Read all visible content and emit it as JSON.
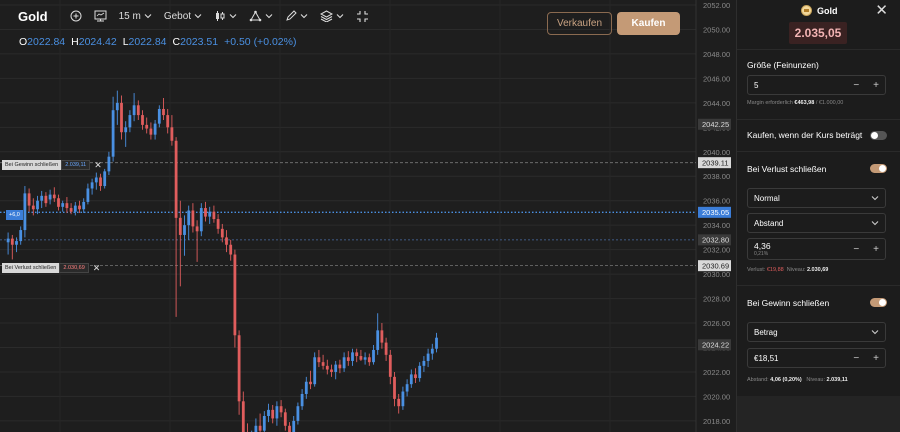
{
  "toolbar": {
    "title": "Gold",
    "timeframe": "15 m",
    "price_type": "Gebot"
  },
  "ohlc": {
    "o_label": "O",
    "o_value": "2022.84",
    "h_label": "H",
    "h_value": "2024.42",
    "l_label": "L",
    "l_value": "2022.84",
    "c_label": "C",
    "c_value": "2023.51",
    "change": "+0.50 (+0.02%)"
  },
  "trade_buttons": {
    "sell": "Verkaufen",
    "buy": "Kaufen"
  },
  "order_lines": {
    "take_profit": {
      "label": "Bei Gewinn schließen",
      "value": "2.039,11"
    },
    "stop_loss": {
      "label": "Bei Verlust schließen",
      "value": "2.030,69"
    },
    "position": {
      "label": "+6,0"
    }
  },
  "chart_data": {
    "type": "candlestick",
    "instrument": "Gold",
    "interval": "15 m",
    "ylim": [
      2017.5,
      2052
    ],
    "y_ticks": [
      "2052.00",
      "2050.00",
      "2048.00",
      "2046.00",
      "2044.00",
      "2042.00",
      "2040.00",
      "2038.00",
      "2036.00",
      "2034.00",
      "2032.00",
      "2030.00",
      "2028.00",
      "2026.00",
      "2024.00",
      "2022.00",
      "2020.00",
      "2018.00"
    ],
    "price_labels": [
      {
        "value": 2042.25,
        "text": "2042.25",
        "style": "gray"
      },
      {
        "value": 2039.11,
        "text": "2039.11",
        "style": "light"
      },
      {
        "value": 2035.05,
        "text": "2035.05",
        "style": "blue"
      },
      {
        "value": 2032.8,
        "text": "2032.80",
        "style": "gray"
      },
      {
        "value": 2030.69,
        "text": "2030.69",
        "style": "light"
      },
      {
        "value": 2024.22,
        "text": "2024.22",
        "style": "gray"
      }
    ],
    "horizontal_lines": [
      {
        "value": 2039.11,
        "style": "dashed-gray"
      },
      {
        "value": 2035.05,
        "style": "dotted-blue"
      },
      {
        "value": 2032.8,
        "style": "dashed-blue"
      },
      {
        "value": 2030.69,
        "style": "dashed-gray"
      }
    ],
    "colors": {
      "up": "#4a90e2",
      "down": "#e05d5d"
    },
    "candles": [
      [
        2032.6,
        2033.4,
        2031.6,
        2032.9
      ],
      [
        2032.9,
        2033.2,
        2031.2,
        2032.4
      ],
      [
        2032.4,
        2033.0,
        2031.8,
        2032.7
      ],
      [
        2032.7,
        2033.9,
        2032.4,
        2033.6
      ],
      [
        2033.6,
        2037.2,
        2033.0,
        2036.6
      ],
      [
        2036.6,
        2037.0,
        2035.1,
        2035.6
      ],
      [
        2035.6,
        2036.2,
        2034.8,
        2035.3
      ],
      [
        2035.3,
        2036.4,
        2034.9,
        2036.0
      ],
      [
        2036.0,
        2036.8,
        2035.4,
        2036.4
      ],
      [
        2036.4,
        2036.7,
        2035.5,
        2035.8
      ],
      [
        2036.1,
        2036.9,
        2035.7,
        2036.5
      ],
      [
        2036.5,
        2037.1,
        2035.9,
        2036.2
      ],
      [
        2036.2,
        2036.5,
        2035.2,
        2035.5
      ],
      [
        2035.5,
        2036.0,
        2035.1,
        2035.8
      ],
      [
        2035.8,
        2036.3,
        2035.0,
        2035.4
      ],
      [
        2035.4,
        2035.8,
        2034.9,
        2035.1
      ],
      [
        2035.1,
        2035.9,
        2034.8,
        2035.6
      ],
      [
        2035.6,
        2036.0,
        2035.0,
        2035.3
      ],
      [
        2035.3,
        2036.2,
        2035.0,
        2035.9
      ],
      [
        2035.9,
        2037.4,
        2035.7,
        2037.0
      ],
      [
        2037.0,
        2037.8,
        2036.5,
        2037.5
      ],
      [
        2037.5,
        2038.3,
        2036.9,
        2037.9
      ],
      [
        2037.9,
        2038.2,
        2036.8,
        2037.2
      ],
      [
        2037.2,
        2038.6,
        2037.0,
        2038.4
      ],
      [
        2038.4,
        2040.0,
        2038.1,
        2039.6
      ],
      [
        2039.6,
        2044.5,
        2039.2,
        2043.4
      ],
      [
        2043.4,
        2045.0,
        2042.2,
        2044.0
      ],
      [
        2044.0,
        2044.6,
        2041.0,
        2041.6
      ],
      [
        2041.6,
        2042.5,
        2040.4,
        2042.0
      ],
      [
        2042.0,
        2043.4,
        2041.6,
        2043.0
      ],
      [
        2043.0,
        2044.8,
        2042.5,
        2043.8
      ],
      [
        2043.8,
        2044.2,
        2042.6,
        2043.0
      ],
      [
        2043.0,
        2043.4,
        2041.8,
        2042.2
      ],
      [
        2042.2,
        2042.8,
        2041.5,
        2041.9
      ],
      [
        2041.9,
        2042.4,
        2041.0,
        2041.4
      ],
      [
        2041.4,
        2042.6,
        2041.0,
        2042.3
      ],
      [
        2042.3,
        2043.8,
        2042.0,
        2043.5
      ],
      [
        2043.5,
        2044.4,
        2042.6,
        2043.0
      ],
      [
        2043.0,
        2043.5,
        2041.5,
        2042.0
      ],
      [
        2042.0,
        2043.0,
        2040.5,
        2040.9
      ],
      [
        2040.9,
        2041.2,
        2026.5,
        2034.6
      ],
      [
        2034.6,
        2036.0,
        2029.0,
        2033.2
      ],
      [
        2033.2,
        2034.8,
        2031.5,
        2034.0
      ],
      [
        2034.0,
        2035.6,
        2032.8,
        2035.2
      ],
      [
        2035.2,
        2035.8,
        2033.4,
        2033.9
      ],
      [
        2033.9,
        2034.4,
        2031.0,
        2033.5
      ],
      [
        2033.5,
        2035.8,
        2033.1,
        2035.4
      ],
      [
        2035.4,
        2035.9,
        2034.3,
        2034.7
      ],
      [
        2034.7,
        2035.5,
        2034.1,
        2035.1
      ],
      [
        2035.1,
        2035.6,
        2034.2,
        2034.5
      ],
      [
        2034.5,
        2034.9,
        2033.3,
        2033.7
      ],
      [
        2033.7,
        2034.1,
        2032.6,
        2033.0
      ],
      [
        2033.0,
        2033.6,
        2031.8,
        2032.4
      ],
      [
        2032.4,
        2032.8,
        2031.1,
        2031.6
      ],
      [
        2031.6,
        2032.0,
        2024.0,
        2025.0
      ],
      [
        2025.0,
        2025.4,
        2018.5,
        2019.6
      ],
      [
        2019.6,
        2020.4,
        2015.5,
        2017.0
      ],
      [
        2017.0,
        2017.8,
        2014.0,
        2015.4
      ],
      [
        2015.4,
        2017.2,
        2014.8,
        2016.8
      ],
      [
        2016.8,
        2018.2,
        2016.2,
        2017.6
      ],
      [
        2017.6,
        2018.6,
        2016.6,
        2017.2
      ],
      [
        2017.2,
        2018.8,
        2016.9,
        2018.4
      ],
      [
        2018.4,
        2019.4,
        2017.9,
        2018.9
      ],
      [
        2018.9,
        2019.3,
        2017.8,
        2018.2
      ],
      [
        2018.2,
        2019.6,
        2017.6,
        2019.2
      ],
      [
        2019.2,
        2019.7,
        2018.3,
        2018.7
      ],
      [
        2018.7,
        2019.0,
        2017.2,
        2017.6
      ],
      [
        2017.6,
        2017.9,
        2016.2,
        2016.8
      ],
      [
        2016.8,
        2018.4,
        2016.4,
        2018.0
      ],
      [
        2018.0,
        2019.5,
        2017.7,
        2019.2
      ],
      [
        2019.2,
        2020.6,
        2018.9,
        2020.2
      ],
      [
        2020.2,
        2021.6,
        2019.8,
        2021.2
      ],
      [
        2021.2,
        2022.1,
        2020.6,
        2021.0
      ],
      [
        2021.0,
        2023.6,
        2020.8,
        2023.2
      ],
      [
        2023.2,
        2023.8,
        2022.4,
        2022.8
      ],
      [
        2022.8,
        2023.4,
        2022.2,
        2022.5
      ],
      [
        2022.5,
        2023.0,
        2021.8,
        2022.2
      ],
      [
        2022.2,
        2022.6,
        2021.6,
        2022.0
      ],
      [
        2022.0,
        2022.9,
        2021.4,
        2022.6
      ],
      [
        2022.6,
        2023.0,
        2021.9,
        2022.3
      ],
      [
        2022.3,
        2023.6,
        2022.0,
        2023.2
      ],
      [
        2023.2,
        2023.7,
        2022.5,
        2022.9
      ],
      [
        2022.9,
        2023.9,
        2022.5,
        2023.6
      ],
      [
        2023.6,
        2023.9,
        2022.8,
        2023.3
      ],
      [
        2023.3,
        2023.8,
        2022.9,
        2023.0
      ],
      [
        2023.0,
        2023.6,
        2022.6,
        2023.2
      ],
      [
        2023.2,
        2023.5,
        2022.5,
        2022.8
      ],
      [
        2022.8,
        2024.2,
        2022.6,
        2023.8
      ],
      [
        2023.8,
        2026.8,
        2023.4,
        2025.4
      ],
      [
        2025.4,
        2026.0,
        2023.9,
        2024.4
      ],
      [
        2024.4,
        2024.8,
        2022.9,
        2023.4
      ],
      [
        2023.4,
        2023.8,
        2021.0,
        2021.6
      ],
      [
        2021.6,
        2022.0,
        2019.2,
        2019.8
      ],
      [
        2019.8,
        2020.2,
        2018.6,
        2019.2
      ],
      [
        2019.2,
        2020.8,
        2018.9,
        2020.4
      ],
      [
        2020.4,
        2021.4,
        2020.0,
        2021.0
      ],
      [
        2021.0,
        2022.2,
        2020.7,
        2021.8
      ],
      [
        2021.8,
        2022.3,
        2021.1,
        2021.5
      ],
      [
        2021.5,
        2022.8,
        2021.2,
        2022.5
      ],
      [
        2022.5,
        2023.3,
        2022.0,
        2022.9
      ],
      [
        2022.9,
        2023.9,
        2022.4,
        2023.5
      ],
      [
        2023.5,
        2024.3,
        2023.0,
        2023.9
      ],
      [
        2023.9,
        2025.2,
        2023.6,
        2024.8
      ]
    ]
  },
  "panel": {
    "asset": "Gold",
    "price": "2.035,05",
    "size_label": "Größe (Feinunzen)",
    "size_value": "5",
    "margin_label": "Margin erforderlich",
    "margin_value": "€463,98",
    "margin_total": "/ €1.000,00",
    "buy_at_label": "Kaufen, wenn der Kurs beträgt",
    "stop_loss": {
      "title": "Bei Verlust schließen",
      "mode": "Normal",
      "type": "Abstand",
      "value": "4,36",
      "percent": "0,21%",
      "loss_label": "Verlust:",
      "loss_value": "€19,88",
      "level_label": "Niveau:",
      "level_value": "2.030,69"
    },
    "take_profit": {
      "title": "Bei Gewinn schließen",
      "type": "Betrag",
      "value": "€18,51",
      "distance_label": "Abstand:",
      "distance_value": "4,06 (0,20%)",
      "level_label": "Niveau:",
      "level_value": "2.039,11"
    },
    "controls": {
      "minus": "−",
      "plus": "+",
      "close": "✕"
    }
  }
}
